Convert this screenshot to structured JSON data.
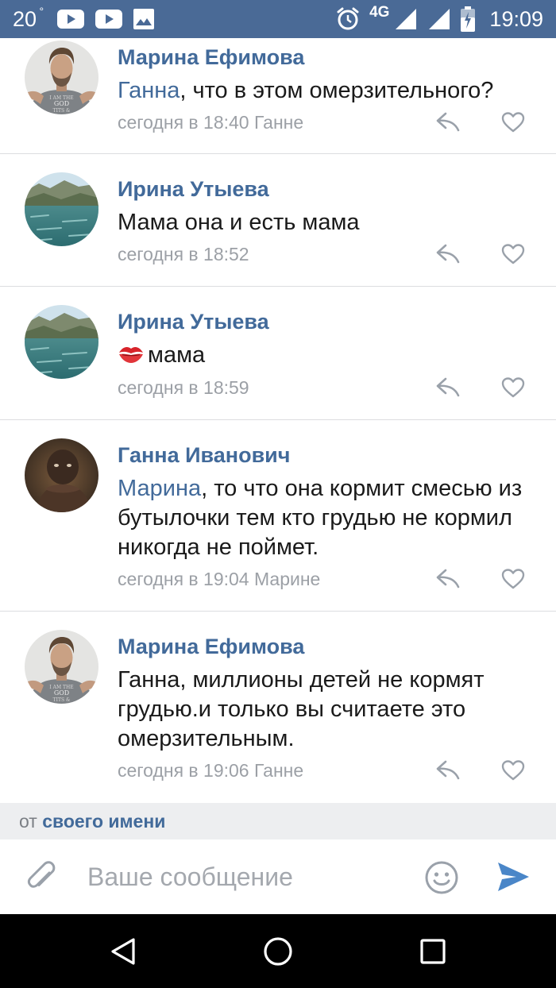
{
  "status_bar": {
    "temperature": "20",
    "degree": "°",
    "network": "4G",
    "time": "19:09",
    "icons": [
      "youtube-icon",
      "youtube-icon",
      "image-icon",
      "alarm-icon",
      "signal-icon",
      "signal-icon",
      "battery-icon"
    ]
  },
  "comments": [
    {
      "author": "Марина Ефимова",
      "mention": "Ганна",
      "text": ", что в этом омерзительного?",
      "meta": "сегодня в 18:40 Ганне",
      "avatar": "avatar-man-tshirt"
    },
    {
      "author": "Ирина Утыева",
      "text": "Мама она и есть мама",
      "meta": "сегодня в 18:52",
      "avatar": "avatar-lake"
    },
    {
      "author": "Ирина Утыева",
      "emoji": "kiss-mark-icon",
      "text": "мама",
      "meta": "сегодня в 18:59",
      "avatar": "avatar-lake"
    },
    {
      "author": "Ганна Иванович",
      "mention": "Марина",
      "text": ", то что она кормит смесью из бутылочки тем кто грудью не кормил никогда не поймет.",
      "meta": "сегодня в 19:04 Марине",
      "avatar": "avatar-child-photo"
    },
    {
      "author": "Марина Ефимова",
      "text": "Ганна, миллионы детей не кормят грудью.и только вы считаете это омерзительным.",
      "meta": "сегодня в 19:06 Ганне",
      "avatar": "avatar-man-tshirt"
    }
  ],
  "from_bar": {
    "prefix": "от",
    "link": "своего имени"
  },
  "composer": {
    "placeholder": "Ваше сообщение",
    "value": ""
  },
  "colors": {
    "status_bar": "#4a6a96",
    "name_link": "#426a9a",
    "meta": "#9ca0a6",
    "send": "#4a86c8"
  },
  "nav": [
    "back-icon",
    "home-icon",
    "recents-icon"
  ]
}
